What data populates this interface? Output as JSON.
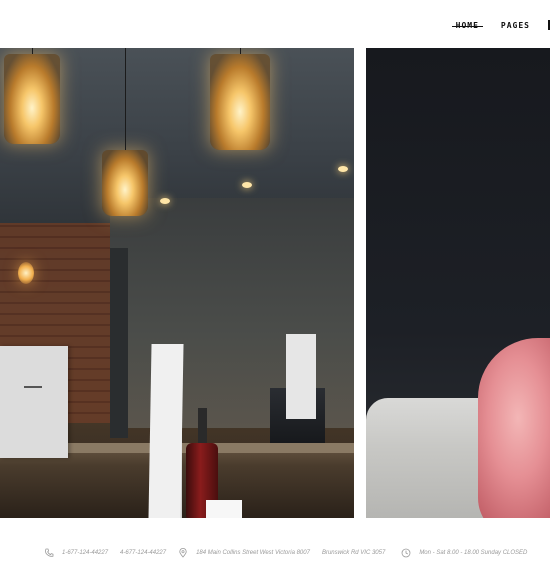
{
  "nav": {
    "items": [
      {
        "label": "Home",
        "active": true
      },
      {
        "label": "Pages",
        "active": false
      }
    ]
  },
  "footer": {
    "phone_icon": "phone-icon",
    "phone_1": "1-677-124-44227",
    "phone_2": "4-677-124-44227",
    "location_icon": "map-pin-icon",
    "address": "184 Main Collins Street West Victoria 8007",
    "address_2": "Brunswick Rd VIC 3057",
    "clock_icon": "clock-icon",
    "hours": "Mon - Sat 8.00 - 18.00 Sunday CLOSED"
  },
  "colors": {
    "footer_text": "#9a9a9a",
    "nav_text": "#111111",
    "background": "#ffffff"
  }
}
